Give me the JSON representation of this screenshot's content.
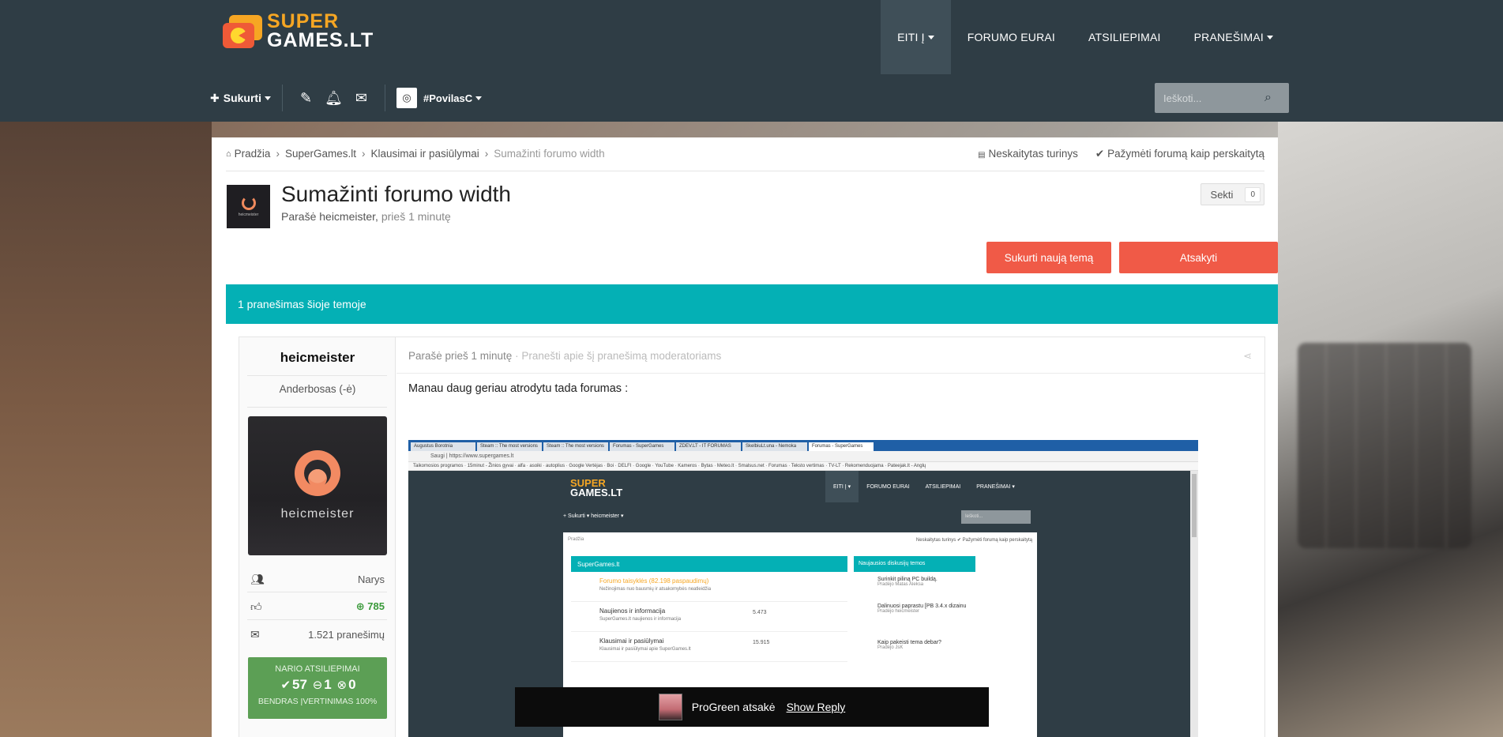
{
  "header": {
    "logo": {
      "line1": "SUPER",
      "line2": "GAMES.LT"
    },
    "nav": [
      {
        "label": "EITI Į",
        "dropdown": true,
        "active": true
      },
      {
        "label": "FORUMO EURAI",
        "dropdown": false
      },
      {
        "label": "ATSILIEPIMAI",
        "dropdown": false
      },
      {
        "label": "PRANEŠIMAI",
        "dropdown": true
      }
    ]
  },
  "userbar": {
    "create_label": "Sukurti",
    "username": "#PovilasC",
    "search_placeholder": "Ieškoti..."
  },
  "breadcrumb": {
    "items": [
      "Pradžia",
      "SuperGames.lt",
      "Klausimai ir pasiūlymai",
      "Sumažinti forumo width"
    ],
    "unread_label": "Neskaitytas turinys",
    "mark_read_label": "Pažymėti forumą kaip perskaitytą"
  },
  "topic": {
    "avatar_text": "heicmeister",
    "title": "Sumažinti forumo width",
    "meta_prefix": "Parašė heicmeister,",
    "meta_time": "prieš 1 minutę",
    "follow_label": "Sekti",
    "follow_count": "0",
    "new_topic_label": "Sukurti naują temą",
    "reply_label": "Atsakyti",
    "count_label": "1 pranešimas šioje temoje"
  },
  "post": {
    "author": "heicmeister",
    "rank": "Anderbosas (-ė)",
    "photo_name": "heicmeister",
    "group": "Narys",
    "reputation": "785",
    "posts": "1.521 pranešimų",
    "rep_box": {
      "title": "NARIO ATSILIEPIMAI",
      "positive": "57",
      "neutral": "1",
      "negative": "0",
      "total": "BENDRAS ĮVERTINIMAS 100%"
    },
    "meta_written": "Parašė prieš 1 minutę",
    "meta_report": "· Pranešti apie šį pranešimą moderatoriams",
    "text": "Manau daug geriau atrodytu tada forumas :"
  },
  "embedded": {
    "tabs": [
      "Augustus Borotnia",
      "Steam :: The most versions",
      "Steam :: The most versions",
      "Forumas - SuperGames",
      "ZDEV.LT - IT FORUMAS",
      "SkelbiuLt.una - Nemoka",
      "Forumas - SuperGames"
    ],
    "address": "Saugi | https://www.supergames.lt",
    "bookmarks": "Taikomosios programos · 15minut - Žinios gyvai · alfa · asoiki · autoplius · Google Vertėjas · Boi · DELFI · Google · YouTube · Kameros · Bytas · Meteo.lt · Smalsus.net · Forumas · Teksto vertimas · TV-LT · Rekomenduojama · Pateejak.lt - Anglų",
    "logo1": "SUPER",
    "logo2": "GAMES.LT",
    "nav": [
      "EITI Į ▾",
      "FORUMO EURAI",
      "ATSILIEPIMAI",
      "PRANEŠIMAI ▾"
    ],
    "user": "+ Sukurti ▾      heicmeister ▾",
    "search": "Ieškoti...",
    "crumb": "Pradžia",
    "crumb_actions": "Neskaitytas turinys   ✔ Pažymėti forumą kaip perskaitytą",
    "category": "SuperGames.lt",
    "rows": [
      {
        "title": "Forumo taisyklės",
        "extra": "(82.198 paspaudimų)",
        "sub": "Nežinojimas nuo bausmių ir atsakomybės neatleidžia",
        "num": ""
      },
      {
        "title": "Naujienos ir informacija",
        "extra": "",
        "sub": "SuperGames.lt naujienos ir informacija",
        "num": "5.473"
      },
      {
        "title": "Klausimai ir pasiūlymai",
        "extra": "",
        "sub": "Klausimai ir pasiūlymai apie SuperGames.lt",
        "num": "15.915"
      }
    ],
    "side_title": "Naujausios diskusijų temos",
    "side_items": [
      {
        "title": "Surinkit piliną PC buildą.",
        "sub": "Pradėjo Matas Aleksa"
      },
      {
        "title": "Dalinuosi paprastu [PB 3.4.x dizainu",
        "sub": "Pradėjo heicmeister"
      },
      {
        "title": "Kaip pakeisti tema debar?",
        "sub": "Pradėjo JsK"
      }
    ]
  },
  "toast": {
    "text": "ProGreen atsakė",
    "action": "Show Reply"
  }
}
